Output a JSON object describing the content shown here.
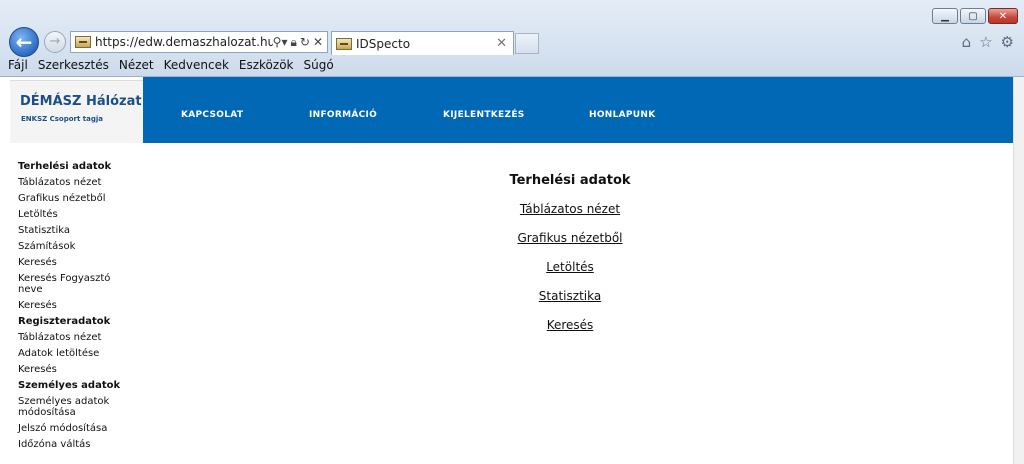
{
  "browser": {
    "url": "https://edw.demaszhalozat.hu/",
    "tab_title": "IDSpecto",
    "menu": [
      "Fájl",
      "Szerkesztés",
      "Nézet",
      "Kedvencek",
      "Eszközök",
      "Súgó"
    ]
  },
  "site": {
    "brand_name": "DÉMÁSZ Hálózat",
    "brand_sub": "ENKSZ Csoport tagja",
    "nav": [
      "KAPCSOLAT",
      "INFORMÁCIÓ",
      "KIJELENTKEZÉS",
      "HONLAPUNK"
    ]
  },
  "sidebar": {
    "groups": [
      {
        "title": "Terhelési adatok",
        "items": [
          "Táblázatos nézet",
          "Grafikus nézetből",
          "Letöltés",
          "Statisztika",
          "Számítások",
          "Keresés",
          "Keresés Fogyasztó neve",
          "Keresés"
        ]
      },
      {
        "title": "Regiszteradatok",
        "items": [
          "Táblázatos nézet",
          "Adatok letöltése",
          "Keresés"
        ]
      },
      {
        "title": "Személyes adatok",
        "items": [
          "Személyes adatok módosítása",
          "Jelszó módosítása",
          "Időzóna váltás"
        ]
      }
    ]
  },
  "content": {
    "title": "Terhelési adatok",
    "links": [
      "Táblázatos nézet",
      "Grafikus nézetből",
      "Letöltés",
      "Statisztika",
      "Keresés"
    ]
  }
}
